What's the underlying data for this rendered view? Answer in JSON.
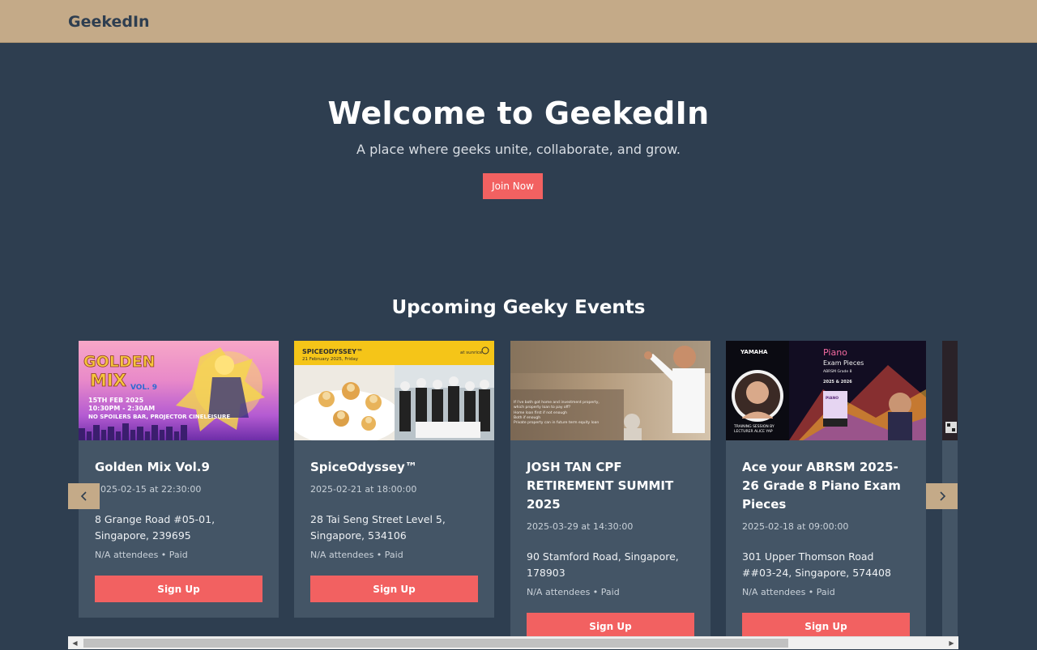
{
  "nav": {
    "brand": "GeekedIn"
  },
  "hero": {
    "title": "Welcome to GeekedIn",
    "subtitle": "A place where geeks unite, collaborate, and grow.",
    "cta": "Join Now"
  },
  "events_section": {
    "title": "Upcoming Geeky Events",
    "prev_icon": "chevron-left-icon",
    "next_icon": "chevron-right-icon",
    "events": [
      {
        "title": "Golden Mix Vol.9",
        "datetime": "2025-02-15 at 22:30:00",
        "address": "8 Grange Road #05-01, Singapore, 239695",
        "meta": "N/A attendees • Paid",
        "button": "Sign Up",
        "image_text": {
          "line1": "GOLDEN",
          "line2": "MIX",
          "vol": "VOL. 9",
          "date": "15TH FEB 2025",
          "time": "10:30PM - 2:30AM",
          "venue": "NO SPOILERS BAR, PROJECTOR CINELEISURE"
        }
      },
      {
        "title": "SpiceOdyssey™",
        "datetime": "2025-02-21 at 18:00:00",
        "address": "28 Tai Seng Street Level 5, Singapore, 534106",
        "meta": "N/A attendees • Paid",
        "button": "Sign Up",
        "image_text": {
          "brand": "SPICEODYSSEY™",
          "date": "21 February 2025, Friday",
          "sponsor": "at sunrice"
        }
      },
      {
        "title": "JOSH TAN CPF RETIREMENT SUMMIT 2025",
        "datetime": "2025-03-29 at 14:30:00",
        "address": "90 Stamford Road, Singapore, 178903",
        "meta": "N/A attendees • Paid",
        "button": "Sign Up",
        "image_text": {
          "q1": "If I've both got home and investment property, which property loan to pay off?",
          "o1": "Home loan first if not enough",
          "o2": "Both if enough",
          "o3": "Private property can in future term equity loan"
        }
      },
      {
        "title": "Ace your ABRSM 2025-26 Grade 8 Piano Exam Pieces",
        "datetime": "2025-02-18 at 09:00:00",
        "address": "301 Upper Thomson Road ##03-24, Singapore, 574408",
        "meta": "N/A attendees • Paid",
        "button": "Sign Up",
        "image_text": {
          "brand": "YAMAHA",
          "title1": "Piano",
          "title2": "Exam Pieces",
          "grade": "ABRSM Grade 8",
          "years": "2025 & 2026",
          "caption1": "TRAINING SESSION BY",
          "caption2": "LECTURER ALICE YAP",
          "book": "PIANO"
        }
      }
    ]
  },
  "colors": {
    "background": "#2e3e50",
    "navbar": "#c4aa88",
    "card": "#445566",
    "accent": "#f26161"
  }
}
